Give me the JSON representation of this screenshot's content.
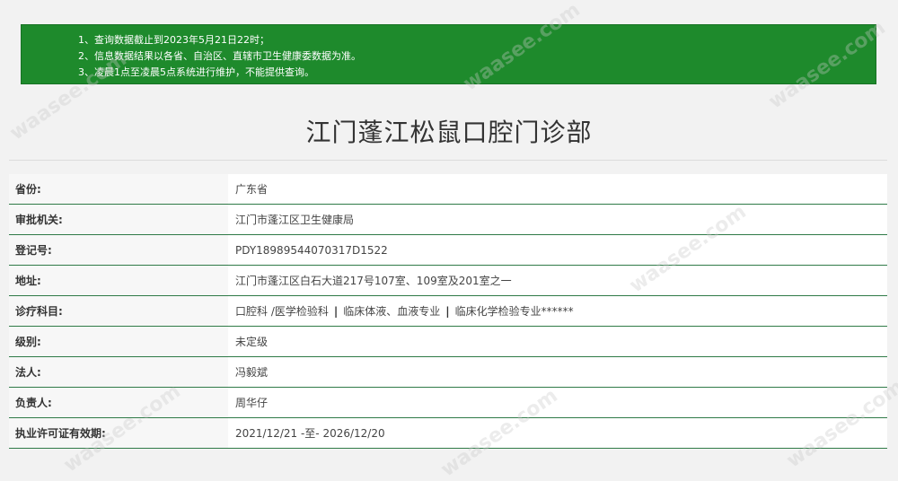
{
  "notice": {
    "items": [
      "1、查询数据截止到2023年5月21日22时；",
      "2、信息数据结果以各省、自治区、直辖市卫生健康委数据为准。",
      "3、凌晨1点至凌晨5点系统进行维护，不能提供查询。"
    ]
  },
  "title": "江门蓬江松鼠口腔门诊部",
  "rows": [
    {
      "label": "省份:",
      "value": "广东省"
    },
    {
      "label": "审批机关:",
      "value": "江门市蓬江区卫生健康局"
    },
    {
      "label": "登记号:",
      "value": "PDY18989544070317D1522"
    },
    {
      "label": "地址:",
      "value": "江门市蓬江区白石大道217号107室、109室及201室之一"
    },
    {
      "label": "诊疗科目:",
      "departments": [
        "口腔科 /医学检验科",
        "临床体液、血液专业",
        "临床化学检验专业******"
      ],
      "separator": "|"
    },
    {
      "label": "级别:",
      "value": "未定级"
    },
    {
      "label": "法人:",
      "value": "冯毅斌"
    },
    {
      "label": "负责人:",
      "value": "周华仔"
    },
    {
      "label": "执业许可证有效期:",
      "value": "2021/12/21 -至- 2026/12/20"
    }
  ],
  "watermark": "waasee.com",
  "colors": {
    "notice_bg": "#1e8a2c",
    "row_border": "#2f7a47"
  }
}
